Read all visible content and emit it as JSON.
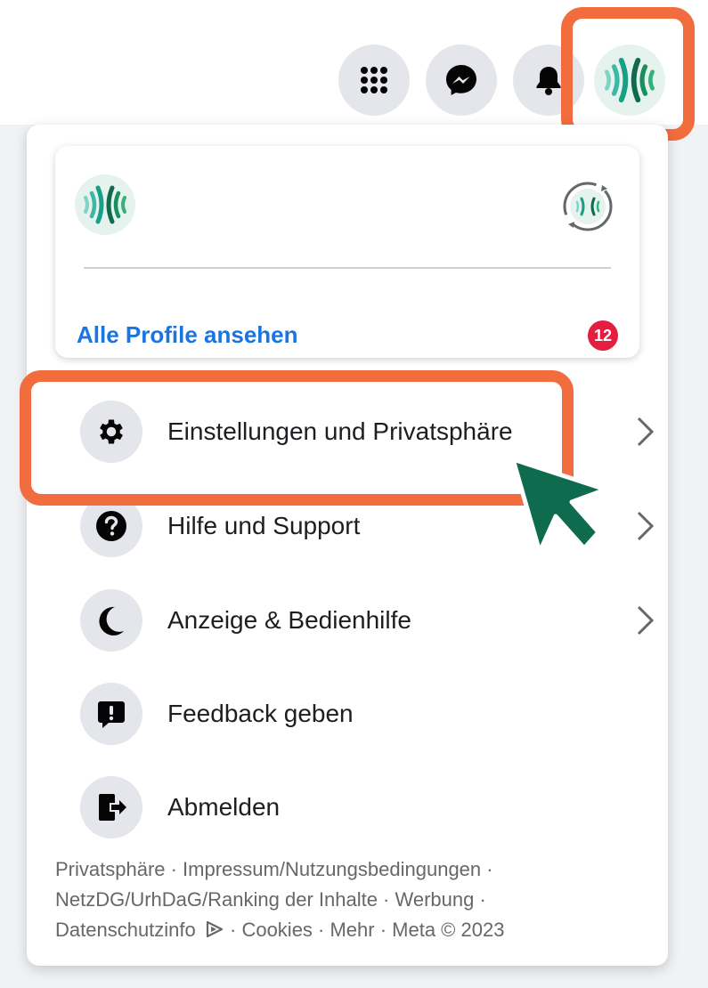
{
  "topbar": {
    "menu_icon": "grid-menu-icon",
    "messenger_icon": "messenger-icon",
    "notifications_icon": "bell-icon",
    "account_avatar": "account-avatar"
  },
  "profile_card": {
    "see_all_profiles_label": "Alle Profile ansehen",
    "profiles_badge": "12",
    "switch_profile_icon": "switch-profile-icon"
  },
  "menu": [
    {
      "label": "Einstellungen und Privatsphäre",
      "icon": "gear-icon",
      "has_chevron": true
    },
    {
      "label": "Hilfe und Support",
      "icon": "question-icon",
      "has_chevron": true
    },
    {
      "label": "Anzeige & Bedienhilfe",
      "icon": "moon-icon",
      "has_chevron": true
    },
    {
      "label": "Feedback geben",
      "icon": "feedback-icon",
      "has_chevron": false
    },
    {
      "label": "Abmelden",
      "icon": "logout-icon",
      "has_chevron": false
    }
  ],
  "footer": {
    "line1": "Privatsphäre · Impressum/Nutzungsbedingungen ·",
    "line2": "NetzDG/UrhDaG/Ranking der Inhalte · Werbung ·",
    "line3_a": "Datenschutzinfo",
    "line3_b": " · Cookies · Mehr · Meta © 2023"
  },
  "colors": {
    "highlight": "#f26d3d",
    "cursor": "#0e6b4d",
    "link": "#1b74e4",
    "badge": "#e41e3f"
  }
}
